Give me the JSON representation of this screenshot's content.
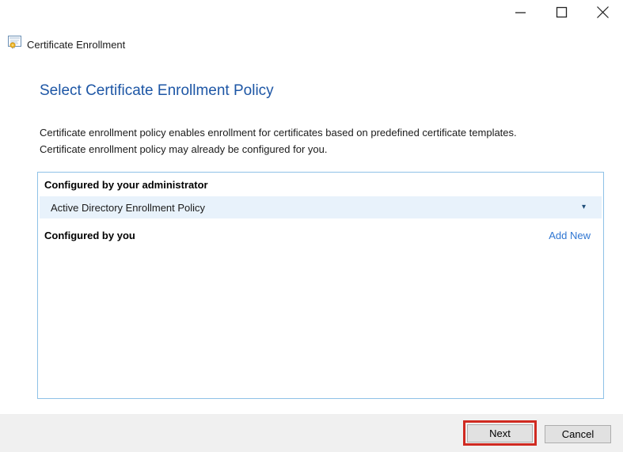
{
  "window": {
    "title": "Certificate Enrollment"
  },
  "heading": "Select Certificate Enrollment Policy",
  "description": [
    "Certificate enrollment policy enables enrollment for certificates based on predefined certificate templates.",
    "Certificate enrollment policy may already be configured for you."
  ],
  "policy_box": {
    "admin_section_label": "Configured by your administrator",
    "admin_policy_selected": "Active Directory Enrollment Policy",
    "dropdown_chevron": "▾",
    "user_section_label": "Configured by you",
    "add_new_label": "Add New"
  },
  "footer": {
    "next_label": "Next",
    "cancel_label": "Cancel"
  },
  "icons": {
    "certificate": "certificate-icon",
    "minimize": "minimize-icon",
    "maximize": "maximize-icon",
    "close": "close-icon",
    "dropdown_chevron": "chevron-down-icon"
  },
  "colors": {
    "heading_blue": "#1d56a5",
    "box_border": "#8ec1e7",
    "dropdown_row_bg": "#e8f2fb",
    "link_blue": "#2f76d2",
    "annotation_red": "#d02a21",
    "footer_gray": "#f0f0f0",
    "button_bg": "#e1e1e1",
    "button_border": "#adadad"
  }
}
